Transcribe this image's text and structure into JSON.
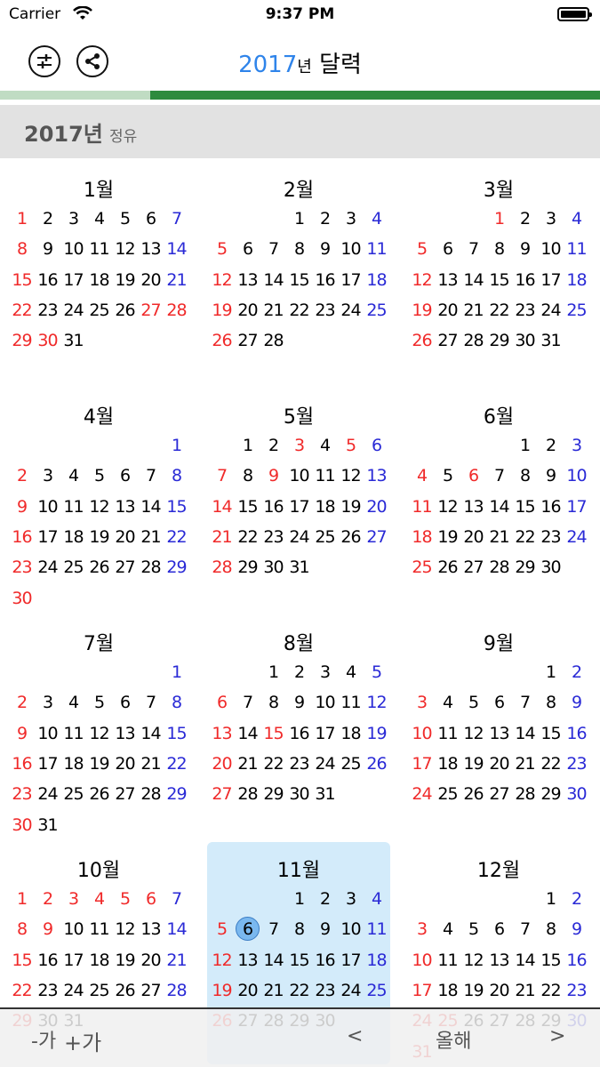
{
  "status_bar": {
    "carrier": "Carrier",
    "time": "9:37 PM"
  },
  "nav": {
    "title_year": "2017",
    "title_year_suffix": "년",
    "title_text": " 달력",
    "left_icon": "sliders-icon",
    "share_icon": "share-icon"
  },
  "progress": {
    "value_fraction": 0.75
  },
  "year_header": {
    "year": "2017년",
    "ganzhi": "정유"
  },
  "colors": {
    "accent": "#2f84ea",
    "sunday_holiday": "#f02a2a",
    "saturday": "#2a2ad6",
    "progress": "#2e8b3e",
    "selected_month_bg": "#d3ebfa"
  },
  "months": [
    {
      "title": "1월",
      "weeks": [
        [
          1,
          2,
          3,
          4,
          5,
          6,
          7
        ],
        [
          8,
          9,
          10,
          11,
          12,
          13,
          14
        ],
        [
          15,
          16,
          17,
          18,
          19,
          20,
          21
        ],
        [
          22,
          23,
          24,
          25,
          26,
          27,
          28
        ],
        [
          29,
          30,
          31
        ]
      ],
      "first_col": 0,
      "red": [
        1,
        8,
        15,
        22,
        29,
        27,
        28,
        30
      ]
    },
    {
      "title": "2월",
      "weeks": [],
      "first_col": 3,
      "days": 28,
      "red": []
    },
    {
      "title": "3월",
      "first_col": 3,
      "days": 31,
      "red": [
        1
      ]
    },
    {
      "title": "4월",
      "first_col": 6,
      "days": 30,
      "red": []
    },
    {
      "title": "5월",
      "first_col": 1,
      "days": 31,
      "red": [
        3,
        5,
        9
      ]
    },
    {
      "title": "6월",
      "first_col": 4,
      "days": 30,
      "red": [
        6
      ]
    },
    {
      "title": "7월",
      "first_col": 6,
      "days": 31,
      "red": []
    },
    {
      "title": "8월",
      "first_col": 2,
      "days": 31,
      "red": [
        15
      ]
    },
    {
      "title": "9월",
      "first_col": 5,
      "days": 30,
      "red": []
    },
    {
      "title": "10월",
      "first_col": 0,
      "days": 31,
      "red": [
        2,
        3,
        4,
        5,
        6,
        9
      ]
    },
    {
      "title": "11월",
      "first_col": 3,
      "days": 30,
      "red": [],
      "selected": true,
      "today": 6
    },
    {
      "title": "12월",
      "first_col": 5,
      "days": 31,
      "red": [
        25
      ]
    }
  ],
  "toolbar": {
    "font_smaller": "-가",
    "font_larger": "+가",
    "prev": "<",
    "this_year": "올해",
    "next": ">"
  }
}
